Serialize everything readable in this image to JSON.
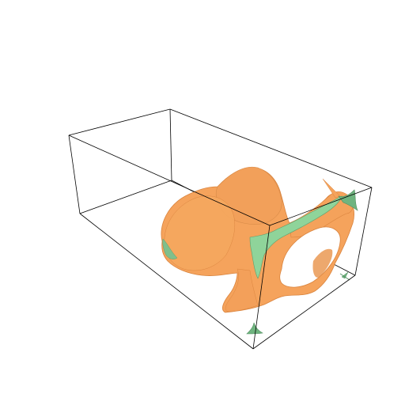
{
  "scene": {
    "background": "#ffffff",
    "bounding_box_color": "#000000",
    "surface_colors": {
      "isosurface": "#f5a35c",
      "isosurface_shade": "#d9833d",
      "cap": "#8fd49a",
      "cap_shade": "#5f9f6c"
    }
  }
}
